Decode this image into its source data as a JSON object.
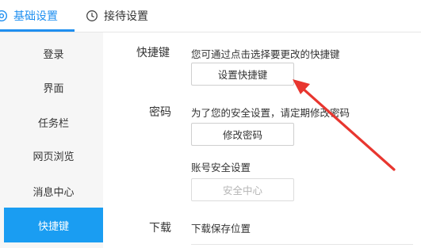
{
  "tabs": {
    "basic": {
      "label": "基础设置",
      "icon": "gear-icon"
    },
    "reception": {
      "label": "接待设置",
      "icon": "clock-icon"
    }
  },
  "sidebar": {
    "items": [
      {
        "label": "登录"
      },
      {
        "label": "界面"
      },
      {
        "label": "任务栏"
      },
      {
        "label": "网页浏览"
      },
      {
        "label": "消息中心"
      },
      {
        "label": "快捷键",
        "active": true
      }
    ]
  },
  "shortcut": {
    "label": "快捷键",
    "description": "您可通过点击选择要更改的快捷键",
    "button": "设置快捷键"
  },
  "password": {
    "label": "密码",
    "description": "为了您的安全设置，请定期修改密码",
    "button": "修改密码"
  },
  "account_security": {
    "description": "账号安全设置",
    "button": "安全中心"
  },
  "download": {
    "label": "下载",
    "description": "下载保存位置"
  },
  "colors": {
    "accent": "#1f8ff0",
    "active_item": "#1a9df2",
    "annotation_arrow": "#e8362f"
  }
}
